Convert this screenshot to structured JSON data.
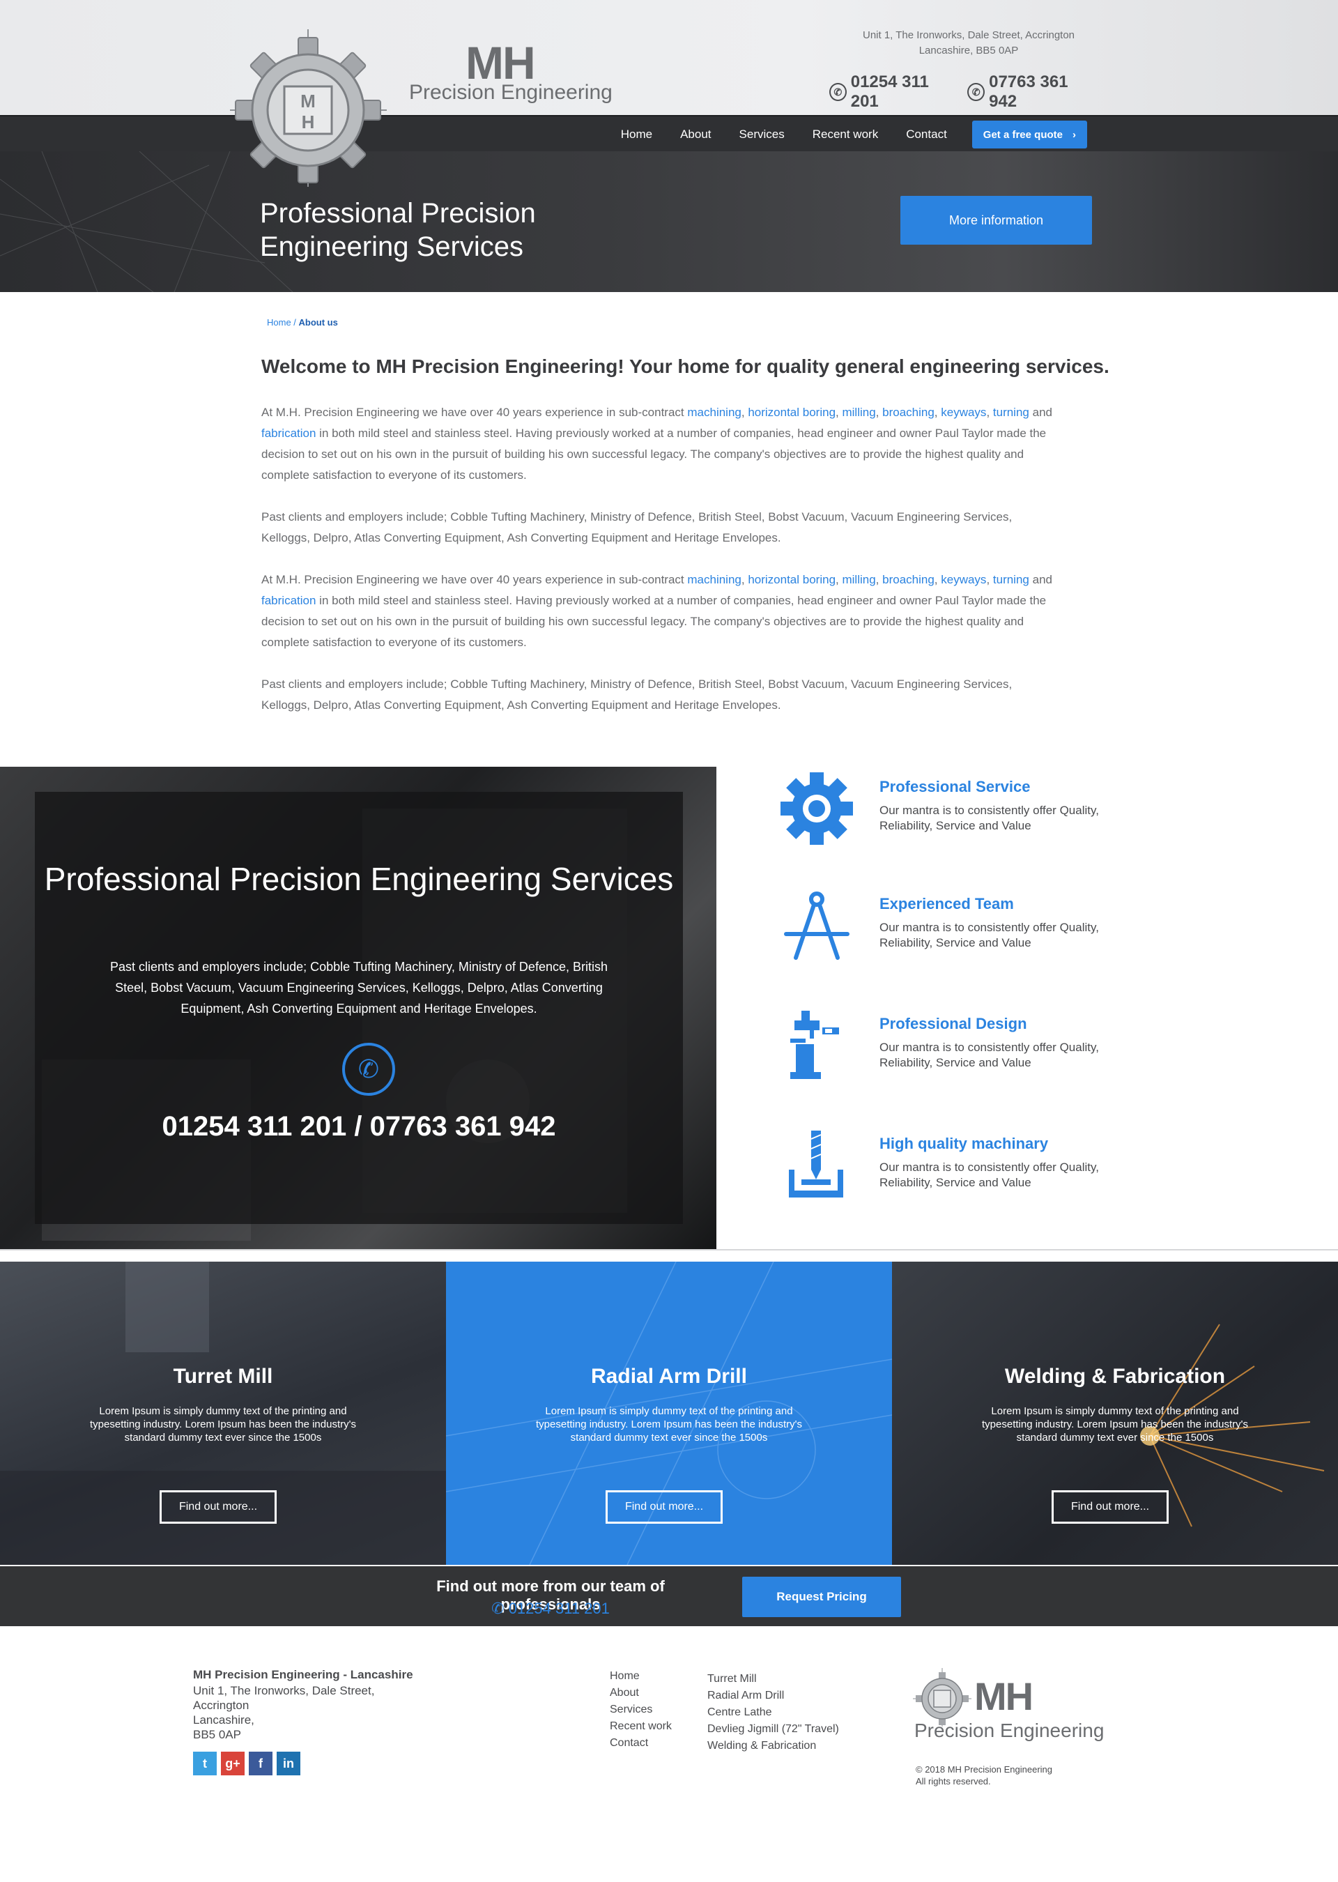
{
  "brand": {
    "mh": "MH",
    "subtitle": "Precision Engineering"
  },
  "header": {
    "address_line1": "Unit 1, The Ironworks, Dale Street, Accrington",
    "address_line2": "Lancashire, BB5 0AP",
    "phone1": "01254 311 201",
    "phone2": "07763 361 942"
  },
  "nav": {
    "items": [
      "Home",
      "About",
      "Services",
      "Recent work",
      "Contact"
    ],
    "quote_label": "Get a free quote"
  },
  "hero": {
    "title": "Professional Precision Engineering Services",
    "button": "More information"
  },
  "breadcrumb": {
    "home": "Home",
    "sep": " / ",
    "current": "About us"
  },
  "content": {
    "heading": "Welcome to MH Precision Engineering! Your home for quality general engineering services.",
    "intro_prefix": "At M.H. Precision Engineering we have over 40 years experience in sub-contract",
    "links": [
      "machining",
      "horizontal boring",
      "milling",
      "broaching",
      "keyways",
      "turning",
      "fabrication"
    ],
    "intro_and": "and",
    "intro_rest": "in both mild steel and stainless steel. Having previously worked at a number of companies, head engineer and owner Paul Taylor made the decision to set out on his own in the pursuit of building his own successful legacy. The company's objectives are to provide the highest quality and complete satisfaction to everyone of its customers.",
    "clients": "Past clients and employers include; Cobble Tufting Machinery, Ministry of Defence, British Steel, Bobst Vacuum, Vacuum Engineering Services, Kelloggs, Delpro, Atlas Converting Equipment, Ash Converting Equipment and Heritage Envelopes."
  },
  "feature": {
    "title": "Professional Precision Engineering Services",
    "text": "Past clients and employers include; Cobble Tufting Machinery, Ministry of Defence, British Steel, Bobst Vacuum, Vacuum Engineering Services, Kelloggs, Delpro, Atlas Converting Equipment, Ash Converting Equipment and Heritage Envelopes.",
    "phones": "01254 311 201 / 07763 361 942"
  },
  "services": [
    {
      "title": "Professional Service",
      "text": "Our mantra is to consistently offer Quality, Reliability, Service and Value",
      "icon": "gear-icon"
    },
    {
      "title": "Experienced Team",
      "text": "Our mantra is to consistently offer Quality, Reliability, Service and Value",
      "icon": "compass-icon"
    },
    {
      "title": "Professional Design",
      "text": "Our mantra is to consistently offer Quality, Reliability, Service and Value",
      "icon": "milling-machine-icon"
    },
    {
      "title": "High quality machinary",
      "text": "Our mantra is to consistently offer Quality, Reliability, Service and Value",
      "icon": "drill-bit-icon"
    }
  ],
  "cards": [
    {
      "title": "Turret Mill",
      "text": "Lorem Ipsum is simply dummy text of the printing and typesetting industry. Lorem Ipsum has been the industry's standard dummy text ever since the 1500s",
      "button": "Find out more..."
    },
    {
      "title": "Radial Arm Drill",
      "text": "Lorem Ipsum is simply dummy text of the printing and typesetting industry. Lorem Ipsum has been the industry's standard dummy text ever since the 1500s",
      "button": "Find out more..."
    },
    {
      "title": "Welding & Fabrication",
      "text": "Lorem Ipsum is simply dummy text of the printing and typesetting industry. Lorem Ipsum has been the industry's standard dummy text ever since the 1500s",
      "button": "Find out more..."
    }
  ],
  "cta": {
    "text": "Find out more from our team of professionals",
    "phone": "01254 311 201",
    "button": "Request Pricing"
  },
  "footer": {
    "company": "MH Precision Engineering - Lancashire",
    "address": [
      "Unit 1, The Ironworks, Dale Street,",
      "Accrington",
      "Lancashire,",
      "BB5 0AP"
    ],
    "nav_links": [
      "Home",
      "About",
      "Services",
      "Recent work",
      "Contact"
    ],
    "service_links": [
      "Turret Mill",
      "Radial Arm Drill",
      "Centre Lathe",
      "Devlieg Jigmill (72\" Travel)",
      "Welding & Fabrication"
    ],
    "copyright1": "© 2018 MH Precision Engineering",
    "copyright2": "All rights reserved.",
    "socials": [
      {
        "name": "twitter",
        "glyph": "t",
        "color": "#3aa0e0"
      },
      {
        "name": "google-plus",
        "glyph": "g+",
        "color": "#d9443a"
      },
      {
        "name": "facebook",
        "glyph": "f",
        "color": "#3b5a9a"
      },
      {
        "name": "linkedin",
        "glyph": "in",
        "color": "#1f72b0"
      }
    ]
  },
  "colors": {
    "accent": "#2b83e0",
    "nav_bg": "#2f3033",
    "cta_bg": "#333436"
  }
}
